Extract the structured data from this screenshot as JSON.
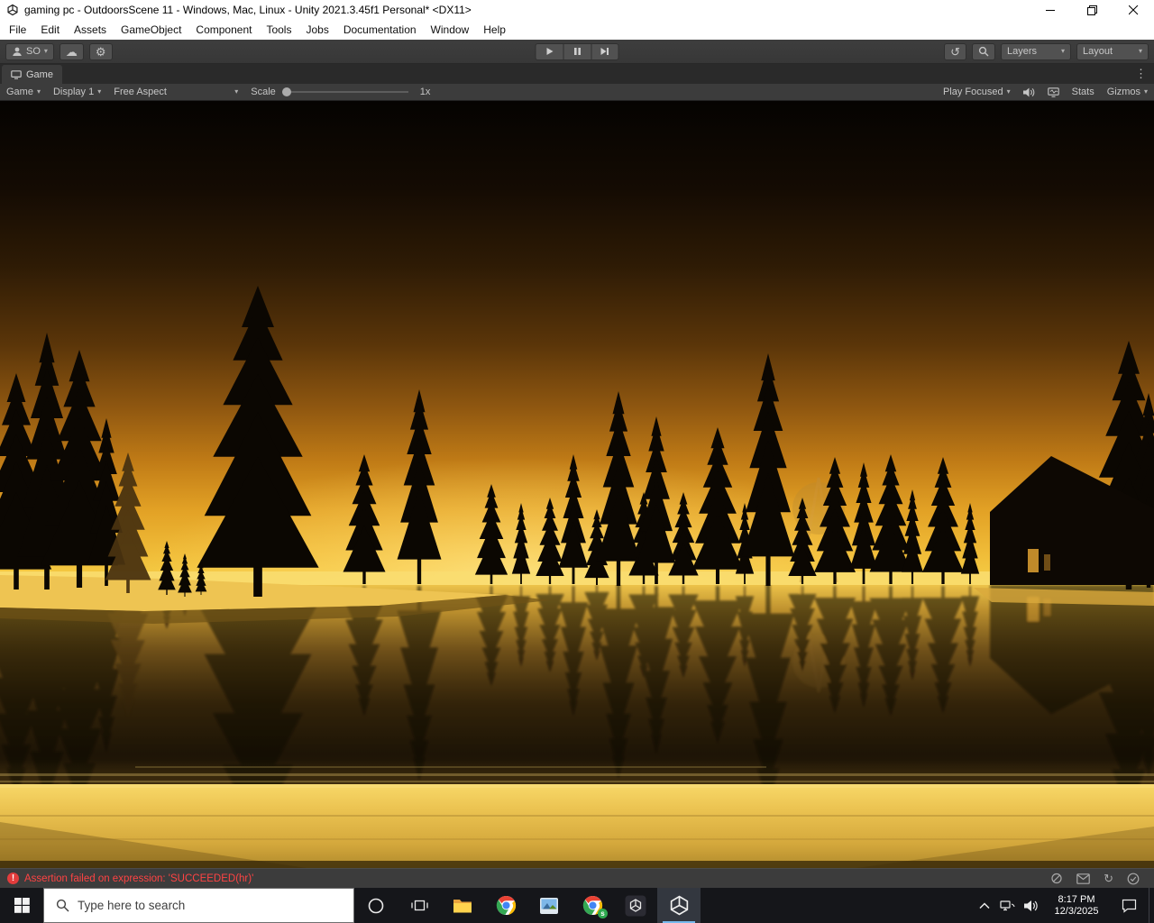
{
  "window": {
    "title": "gaming pc - OutdoorsScene 11 - Windows, Mac, Linux - Unity 2021.3.45f1 Personal* <DX11>"
  },
  "menu_bar": {
    "items": [
      "File",
      "Edit",
      "Assets",
      "GameObject",
      "Component",
      "Tools",
      "Jobs",
      "Documentation",
      "Window",
      "Help"
    ]
  },
  "main_toolbar": {
    "account_label": "SO",
    "layers_dropdown": "Layers",
    "layout_dropdown": "Layout"
  },
  "game_tab": {
    "label": "Game"
  },
  "game_toolbar": {
    "display_target_dropdown": "Game",
    "display_dropdown": "Display 1",
    "aspect_dropdown": "Free Aspect",
    "scale_label": "Scale",
    "scale_value": "1x",
    "play_focused_dropdown": "Play Focused",
    "stats_button": "Stats",
    "gizmos_dropdown": "Gizmos"
  },
  "status_bar": {
    "error_message": "Assertion failed on expression: 'SUCCEEDED(hr)'"
  },
  "taskbar": {
    "search_placeholder": "Type here to search",
    "chrome_badge": "s",
    "clock": {
      "time": "8:17 PM",
      "date": "12/3/2025"
    }
  },
  "scene": {
    "description": "Sunset over a lake: silhouetted pine forest and a cabin reflected in still water, bright golden foreground shore"
  }
}
